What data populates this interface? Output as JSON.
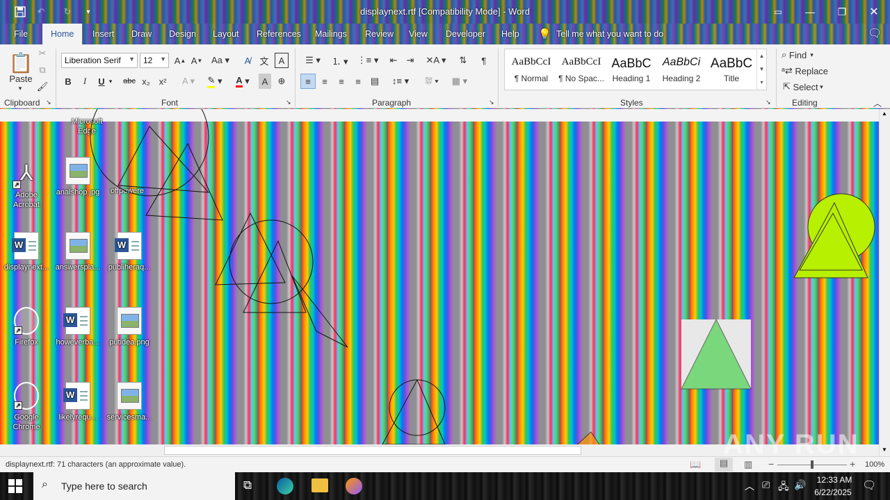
{
  "titlebar": {
    "title": "displaynext.rtf [Compatibility Mode]  -  Word"
  },
  "tabs": [
    {
      "label": "File"
    },
    {
      "label": "Home"
    },
    {
      "label": "Insert"
    },
    {
      "label": "Draw"
    },
    {
      "label": "Design"
    },
    {
      "label": "Layout"
    },
    {
      "label": "References"
    },
    {
      "label": "Mailings"
    },
    {
      "label": "Review"
    },
    {
      "label": "View"
    },
    {
      "label": "Developer"
    },
    {
      "label": "Help"
    }
  ],
  "tell_me": "Tell me what you want to do",
  "ribbon": {
    "clipboard": {
      "paste_label": "Paste",
      "group_label": "Clipboard"
    },
    "font": {
      "family": "Liberation Serif",
      "size": "12",
      "group_label": "Font",
      "bold": "B",
      "italic": "I",
      "underline": "U",
      "strike": "abc",
      "subscript": "x₂",
      "superscript": "x²"
    },
    "paragraph": {
      "group_label": "Paragraph"
    },
    "styles": {
      "group_label": "Styles",
      "items": [
        {
          "preview": "AaBbCcI",
          "name": "¶ Normal"
        },
        {
          "preview": "AaBbCcI",
          "name": "¶ No Spac..."
        },
        {
          "preview": "AaBbC",
          "name": "Heading 1"
        },
        {
          "preview": "AaBbCi",
          "name": "Heading 2"
        },
        {
          "preview": "AaBbC",
          "name": "Title"
        }
      ]
    },
    "editing": {
      "group_label": "Editing",
      "find": "Find",
      "replace": "Replace",
      "select": "Select"
    }
  },
  "desktop_icons": [
    {
      "label": "Adobe Acrobat",
      "type": "app"
    },
    {
      "label": "analshop.jpg",
      "type": "image"
    },
    {
      "label": "offpowere",
      "type": "text"
    },
    {
      "label": "displaynext...",
      "type": "word"
    },
    {
      "label": "answerspla...",
      "type": "image"
    },
    {
      "label": "publiheraq...",
      "type": "word"
    },
    {
      "label": "Firefox",
      "type": "app"
    },
    {
      "label": "howeverba...",
      "type": "word"
    },
    {
      "label": "putidea.png",
      "type": "image"
    },
    {
      "label": "Google Chrome",
      "type": "app"
    },
    {
      "label": "likelyrequ...",
      "type": "word"
    },
    {
      "label": "servicesma...",
      "type": "image"
    }
  ],
  "top_partial_labels": {
    "left": "Microsoft Edge"
  },
  "statusbar": {
    "text": "displaynext.rtf: 71 characters (an approximate value).",
    "zoom": "100%"
  },
  "taskbar": {
    "search_placeholder": "Type here to search",
    "time": "12:33 AM",
    "date": "6/22/2025"
  },
  "watermark": "ANY RUN",
  "colors": {
    "word_blue": "#2b579a",
    "ribbon_bg": "#f3f3f3",
    "shape_yellow": "#b7f000"
  }
}
